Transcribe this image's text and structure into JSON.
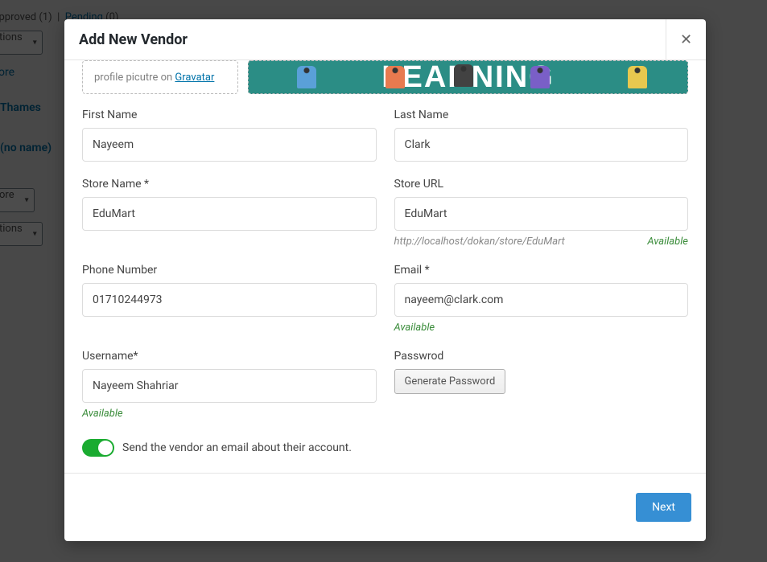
{
  "background": {
    "approved": "Approved",
    "approved_count": "(1)",
    "pending": "Pending",
    "pending_count": "(0)",
    "select1": "tions",
    "link1": "ore",
    "item1": "Thames",
    "item2": "(no name)",
    "select2": "ore",
    "select3": "tions"
  },
  "modal": {
    "title": "Add New Vendor",
    "upload_hint_prefix": "profile picutre on ",
    "upload_hint_link": "Gravatar",
    "banner_text": "LEARNING"
  },
  "form": {
    "first_name": {
      "label": "First Name",
      "value": "Nayeem"
    },
    "last_name": {
      "label": "Last Name",
      "value": "Clark"
    },
    "store_name": {
      "label": "Store Name *",
      "value": "EduMart"
    },
    "store_url": {
      "label": "Store URL",
      "value": "EduMart",
      "helper": "http://localhost/dokan/store/EduMart",
      "status": "Available"
    },
    "phone": {
      "label": "Phone Number",
      "value": "01710244973"
    },
    "email": {
      "label": "Email *",
      "value": "nayeem@clark.com",
      "status": "Available"
    },
    "username": {
      "label": "Username*",
      "value": "Nayeem Shahriar",
      "status": "Available"
    },
    "password": {
      "label": "Passwrod",
      "button": "Generate Password"
    },
    "send_email": "Send the vendor an email about their account."
  },
  "footer": {
    "next": "Next"
  }
}
